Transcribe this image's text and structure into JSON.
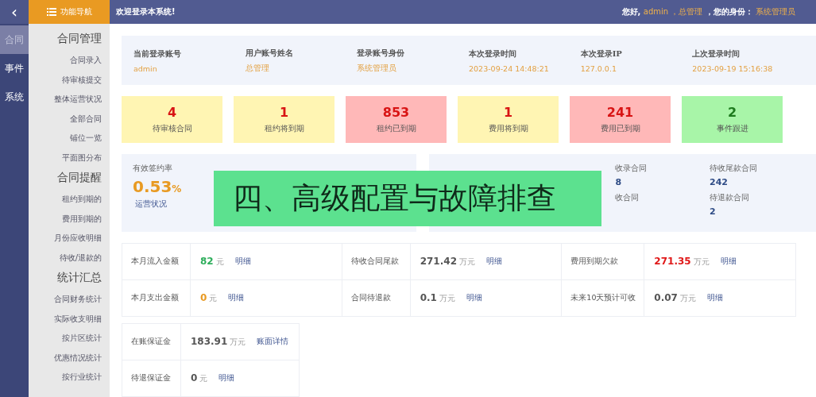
{
  "header": {
    "back_icon": "‹",
    "nav_title": "功能导航",
    "welcome": "欢迎登录本系统!",
    "greeting": [
      {
        "text": "您好,",
        "kind": "plain"
      },
      {
        "text": "admin",
        "kind": "accent"
      },
      {
        "text": "，总管理",
        "kind": "accent"
      },
      {
        "text": "，您的身份：",
        "kind": "plain"
      },
      {
        "text": "系统管理员",
        "kind": "accent"
      }
    ]
  },
  "rail": [
    {
      "label": "合同",
      "selected": true
    },
    {
      "label": "事件",
      "selected": false
    },
    {
      "label": "系统",
      "selected": false
    }
  ],
  "nav_sections": [
    {
      "title": "合同管理",
      "items": [
        "合同录入",
        "待审核提交",
        "整体运营状况",
        "全部合同",
        "铺位一览",
        "平面图分布"
      ]
    },
    {
      "title": "合同提醒",
      "items": [
        "租约到期的",
        "费用到期的",
        "月份应收明细",
        "待收/退款的"
      ]
    },
    {
      "title": "统计汇总",
      "items": [
        "合同财务统计",
        "实际收支明细",
        "按片区统计",
        "优惠情况统计",
        "按行业统计"
      ]
    }
  ],
  "account_info": [
    {
      "label": "当前登录账号",
      "value": "admin"
    },
    {
      "label": "用户账号姓名",
      "value": "总管理"
    },
    {
      "label": "登录账号身份",
      "value": "系统管理员"
    },
    {
      "label": "本次登录时间",
      "value": "2023-09-24 14:48:21"
    },
    {
      "label": "本次登录IP",
      "value": "127.0.0.1"
    },
    {
      "label": "上次登录时间",
      "value": "2023-09-19 15:16:38"
    }
  ],
  "alert_cards": [
    {
      "value": "4",
      "label": "待审核合同",
      "color": "#fff5b3"
    },
    {
      "value": "1",
      "label": "租约将到期",
      "color": "#fff5b3"
    },
    {
      "value": "853",
      "label": "租约已到期",
      "color": "#ffb8b8"
    },
    {
      "value": "1",
      "label": "费用将到期",
      "color": "#fff5b3"
    },
    {
      "value": "241",
      "label": "费用已到期",
      "color": "#ffb8b8"
    },
    {
      "value": "2",
      "label": "事件跟进",
      "color": "#a8f5a8"
    }
  ],
  "rate": {
    "label": "有效签约率",
    "value": "0.53",
    "unit": "%",
    "caption": "运营状况"
  },
  "contract_stats": [
    {
      "label": "收录合同",
      "value": "8"
    },
    {
      "label": "待收尾款合同",
      "value": "242"
    },
    {
      "label": "收合同"
    },
    {
      "label": "待退款合同",
      "value": "2"
    }
  ],
  "finance_rows": [
    [
      {
        "label": "本月流入金额",
        "amount": "82",
        "unit": "元",
        "link": "明细",
        "color": "#2fae5c"
      },
      {
        "label": "待收合同尾款",
        "amount": "271.42",
        "unit": "万元",
        "link": "明细",
        "color": "#555555"
      },
      {
        "label": "费用到期欠款",
        "amount": "271.35",
        "unit": "万元",
        "link": "明细",
        "color": "#e01818"
      }
    ],
    [
      {
        "label": "本月支出金额",
        "amount": "0",
        "unit": "元",
        "link": "明细",
        "color": "#e89a22"
      },
      {
        "label": "合同待退款",
        "amount": "0.1",
        "unit": "万元",
        "link": "明细",
        "color": "#555555"
      },
      {
        "label": "未来10天预计可收",
        "amount": "0.07",
        "unit": "万元",
        "link": "明细",
        "color": "#555555"
      }
    ]
  ],
  "deposit_rows": [
    {
      "label": "在账保证金",
      "amount": "183.91",
      "unit": "万元",
      "link": "账面详情",
      "color": "#555555"
    },
    {
      "label": "待退保证金",
      "amount": "0",
      "unit": "元",
      "link": "明细",
      "color": "#555555"
    }
  ],
  "banner": {
    "text": "四、高级配置与故障排查"
  }
}
